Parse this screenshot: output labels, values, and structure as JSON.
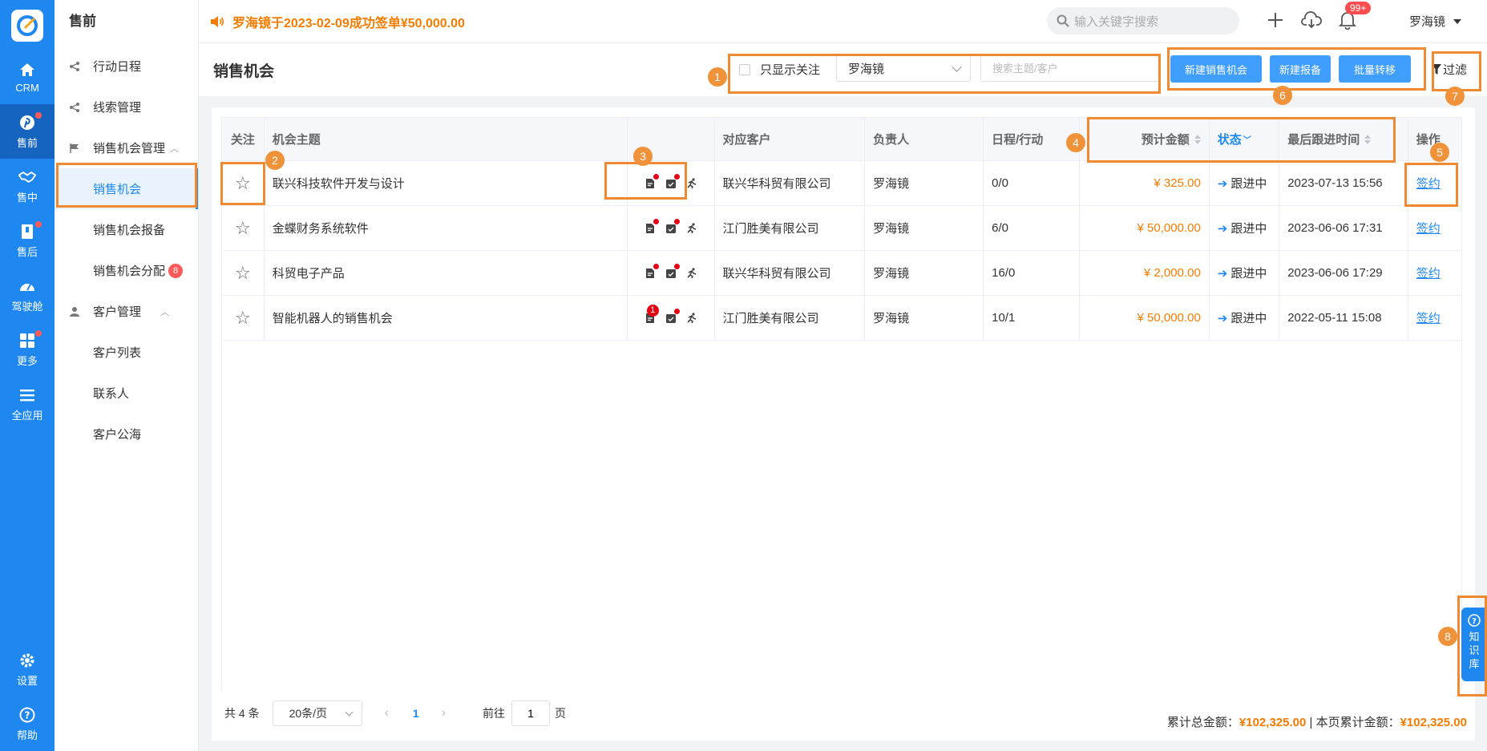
{
  "rail": {
    "items": [
      {
        "label": "CRM",
        "icon": "home-icon"
      },
      {
        "label": "售前",
        "icon": "pinterest-icon"
      },
      {
        "label": "售中",
        "icon": "handshake-icon"
      },
      {
        "label": "售后",
        "icon": "bookmark-icon"
      },
      {
        "label": "驾驶舱",
        "icon": "dashboard-icon"
      },
      {
        "label": "更多",
        "icon": "grid-icon"
      },
      {
        "label": "全应用",
        "icon": "menu-icon"
      }
    ],
    "bottom": [
      {
        "label": "设置",
        "icon": "gear-icon"
      },
      {
        "label": "帮助",
        "icon": "help-icon"
      }
    ]
  },
  "sidebar": {
    "title": "售前",
    "items": [
      {
        "label": "行动日程"
      },
      {
        "label": "线索管理"
      },
      {
        "label": "销售机会管理"
      },
      {
        "label": "销售机会"
      },
      {
        "label": "销售机会报备"
      },
      {
        "label": "销售机会分配",
        "badge": "8"
      },
      {
        "label": "客户管理"
      },
      {
        "label": "客户列表"
      },
      {
        "label": "联系人"
      },
      {
        "label": "客户公海"
      }
    ]
  },
  "topbar": {
    "announcement": "罗海镜于2023-02-09成功签单¥50,000.00",
    "search_placeholder": "输入关键字搜索",
    "bell_badge": "99+",
    "user": "罗海镜"
  },
  "header": {
    "title": "销售机会",
    "only_followed": "只显示关注",
    "owner_select": "罗海镜",
    "keyword_placeholder": "搜索主题/客户",
    "btn_new": "新建销售机会",
    "btn_report": "新建报备",
    "btn_transfer": "批量转移",
    "filter": "过滤"
  },
  "table": {
    "columns": [
      "关注",
      "机会主题",
      "",
      "对应客户",
      "负责人",
      "日程/行动",
      "预计金额",
      "状态",
      "最后跟进时间",
      "操作"
    ],
    "rows": [
      {
        "subject": "联兴科技软件开发与设计",
        "customer": "联兴华科贸有限公司",
        "owner": "罗海镜",
        "schedule": "0/0",
        "amount": "¥ 325.00",
        "status": "跟进中",
        "last": "2023-07-13 15:56",
        "action": "签约",
        "badge": ""
      },
      {
        "subject": "金蝶财务系统软件",
        "customer": "江门胜美有限公司",
        "owner": "罗海镜",
        "schedule": "6/0",
        "amount": "¥ 50,000.00",
        "status": "跟进中",
        "last": "2023-06-06 17:31",
        "action": "签约",
        "badge": ""
      },
      {
        "subject": "科贸电子产品",
        "customer": "联兴华科贸有限公司",
        "owner": "罗海镜",
        "schedule": "16/0",
        "amount": "¥ 2,000.00",
        "status": "跟进中",
        "last": "2023-06-06 17:29",
        "action": "签约",
        "badge": ""
      },
      {
        "subject": "智能机器人的销售机会",
        "customer": "江门胜美有限公司",
        "owner": "罗海镜",
        "schedule": "10/1",
        "amount": "¥ 50,000.00",
        "status": "跟进中",
        "last": "2022-05-11 15:08",
        "action": "签约",
        "badge": "1"
      }
    ]
  },
  "pager": {
    "total": "共 4 条",
    "page_size": "20条/页",
    "current": "1",
    "goto_label": "前往",
    "goto_value": "1",
    "page_unit": "页"
  },
  "totals": {
    "total_label": "累计总金额：",
    "total_value": "¥102,325.00",
    "sep": " | ",
    "page_label": "本页累计金额：",
    "page_value": "¥102,325.00"
  },
  "kb": {
    "chars": [
      "知",
      "识",
      "库"
    ],
    "icon": "question-circle-icon"
  },
  "callouts": [
    "1",
    "2",
    "3",
    "4",
    "5",
    "6",
    "7",
    "8"
  ],
  "colors": {
    "primary": "#1e88f0",
    "accent": "#f57c00",
    "callout": "#f08a32",
    "button": "#409eff"
  }
}
